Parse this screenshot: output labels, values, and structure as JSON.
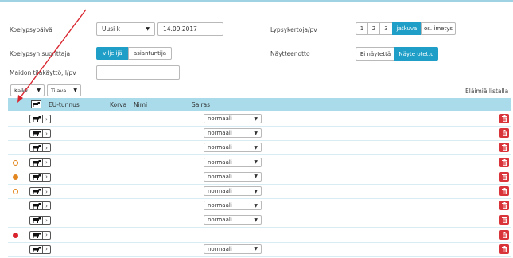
{
  "form": {
    "koepvm_label": "Koelypsypäivä",
    "koepvm_select": "Uusi k",
    "koepvm_date": "14.09.2017",
    "suorittaja_label": "Koelypsyn suorittaja",
    "suorittaja_options": [
      "viljelijä",
      "asiantuntija"
    ],
    "suorittaja_active": "viljelijä",
    "maito_label": "Maidon tilakäyttö, l/pv",
    "maito_value": "",
    "lypsykerrat_label": "Lypsykertoja/pv",
    "lypsykerrat_options": [
      "1",
      "2",
      "3",
      "jatkuva",
      "os. imetys"
    ],
    "lypsykerrat_active": "jatkuva",
    "naytteenotto_label": "Näytteenotto",
    "naytteenotto_options": [
      "Ei näytettä",
      "Näyte otettu"
    ],
    "naytteenotto_active": "Näyte otettu"
  },
  "filters": {
    "kaikki": "Kaikki",
    "tilava": "Tilava",
    "elaimia_listalla": "Eläimiä listalla"
  },
  "table": {
    "headers": {
      "eu_tunnus": "EU-tunnus",
      "korva": "Korva",
      "nimi": "Nimi",
      "sairas": "Sairas"
    },
    "rows": [
      {
        "indicator": "none",
        "sairas": "normaali"
      },
      {
        "indicator": "none",
        "sairas": "normaali"
      },
      {
        "indicator": "none",
        "sairas": "normaali"
      },
      {
        "indicator": "ring-orange",
        "sairas": "normaali"
      },
      {
        "indicator": "fill-orange",
        "sairas": "normaali"
      },
      {
        "indicator": "ring-orange",
        "sairas": "normaali"
      },
      {
        "indicator": "none",
        "sairas": "normaali"
      },
      {
        "indicator": "none",
        "sairas": "normaali"
      },
      {
        "indicator": "fill-red",
        "sairas": ""
      },
      {
        "indicator": "none",
        "sairas": "normaali"
      }
    ]
  },
  "icons": {
    "cow": "cow-icon",
    "chevron": "›",
    "trash": "trash-icon",
    "dropdown": "▼"
  },
  "colors": {
    "accent": "#1f9fc7",
    "header_bg": "#a9dbea",
    "delete": "#d9343a",
    "orange": "#e2861f",
    "red": "#d9242e",
    "annotation_arrow": "#d9242e"
  }
}
